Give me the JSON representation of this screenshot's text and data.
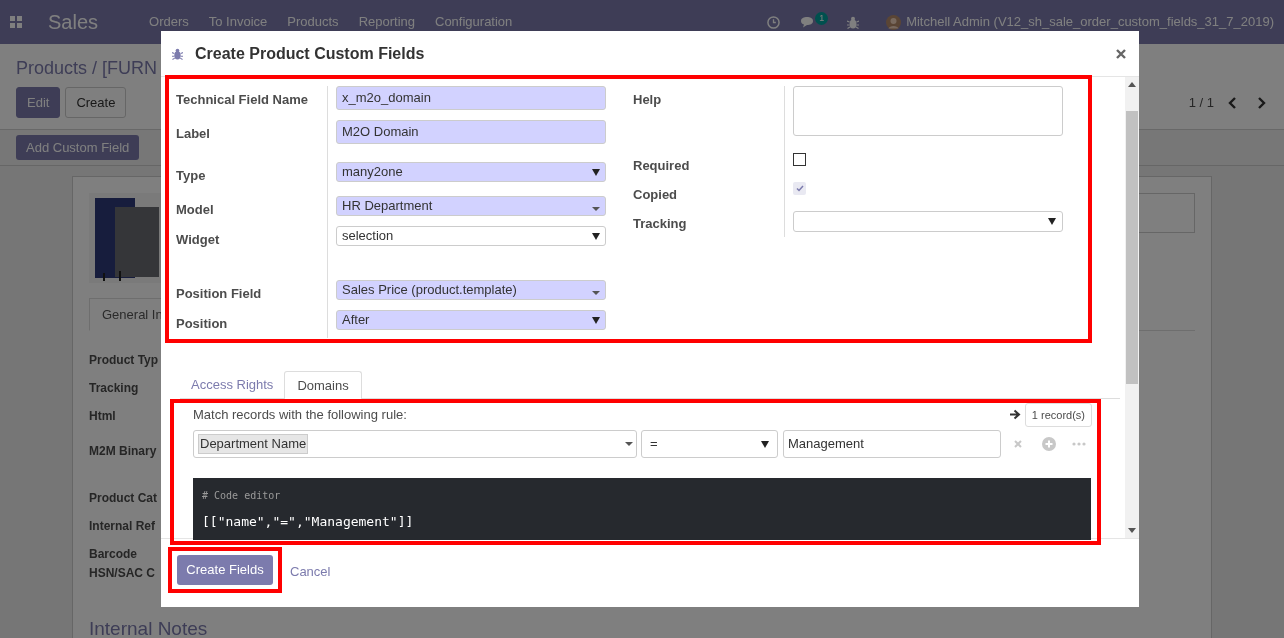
{
  "navbar": {
    "app": "Sales",
    "menu": [
      "Orders",
      "To Invoice",
      "Products",
      "Reporting",
      "Configuration"
    ],
    "chat_count": "1",
    "user": "Mitchell Admin (V12_sh_sale_order_custom_fields_31_7_2019)"
  },
  "page": {
    "breadcrumb": "Products / [FURN",
    "buttons": [
      {
        "label": "Edit",
        "primary": true
      },
      {
        "label": "Create",
        "primary": false
      }
    ],
    "pager": "1 / 1",
    "add_button": "Add Custom Field",
    "tab": "General In",
    "labels": [
      "Product Typ",
      "Tracking",
      "Html",
      "M2M Binary",
      "Product Cat",
      "Internal Ref",
      "Barcode",
      "HSN/SAC C"
    ],
    "section_title": "Internal Notes"
  },
  "dialog": {
    "title": "Create Product Custom Fields",
    "left_fields": [
      {
        "label": "Technical Field Name",
        "kind": "input",
        "value": "x_m2o_domain",
        "required": true
      },
      {
        "label": "Label",
        "kind": "input",
        "value": "M2O Domain",
        "required": true
      },
      {
        "label": "Type",
        "kind": "select",
        "value": "many2one",
        "required": true
      },
      {
        "label": "Model",
        "kind": "many2one",
        "value": "HR Department",
        "required": true
      },
      {
        "label": "Widget",
        "kind": "select",
        "value": "selection",
        "required": false
      },
      {
        "label": "Position Field",
        "kind": "many2one",
        "value": "Sales Price (product.template)",
        "required": true
      },
      {
        "label": "Position",
        "kind": "select",
        "value": "After",
        "required": true
      }
    ],
    "right_fields": [
      {
        "label": "Help",
        "kind": "textarea"
      },
      {
        "label": "Required",
        "kind": "checkbox",
        "checked": false
      },
      {
        "label": "Copied",
        "kind": "checkbox",
        "checked": true
      },
      {
        "label": "Tracking",
        "kind": "select"
      }
    ],
    "tabs": [
      {
        "label": "Access Rights",
        "selected": false
      },
      {
        "label": "Domains",
        "selected": true
      }
    ],
    "domain": {
      "intro": "Match records with the following rule:",
      "record_count": "1 record(s)",
      "field": "Department Name",
      "operator": "=",
      "value": "Management",
      "code_comment": "# Code editor",
      "code": "[[\"name\",\"=\",\"Management\"]]"
    },
    "buttons": [
      {
        "label": "Create Fields",
        "primary": true
      },
      {
        "label": "Cancel",
        "primary": false
      }
    ]
  }
}
